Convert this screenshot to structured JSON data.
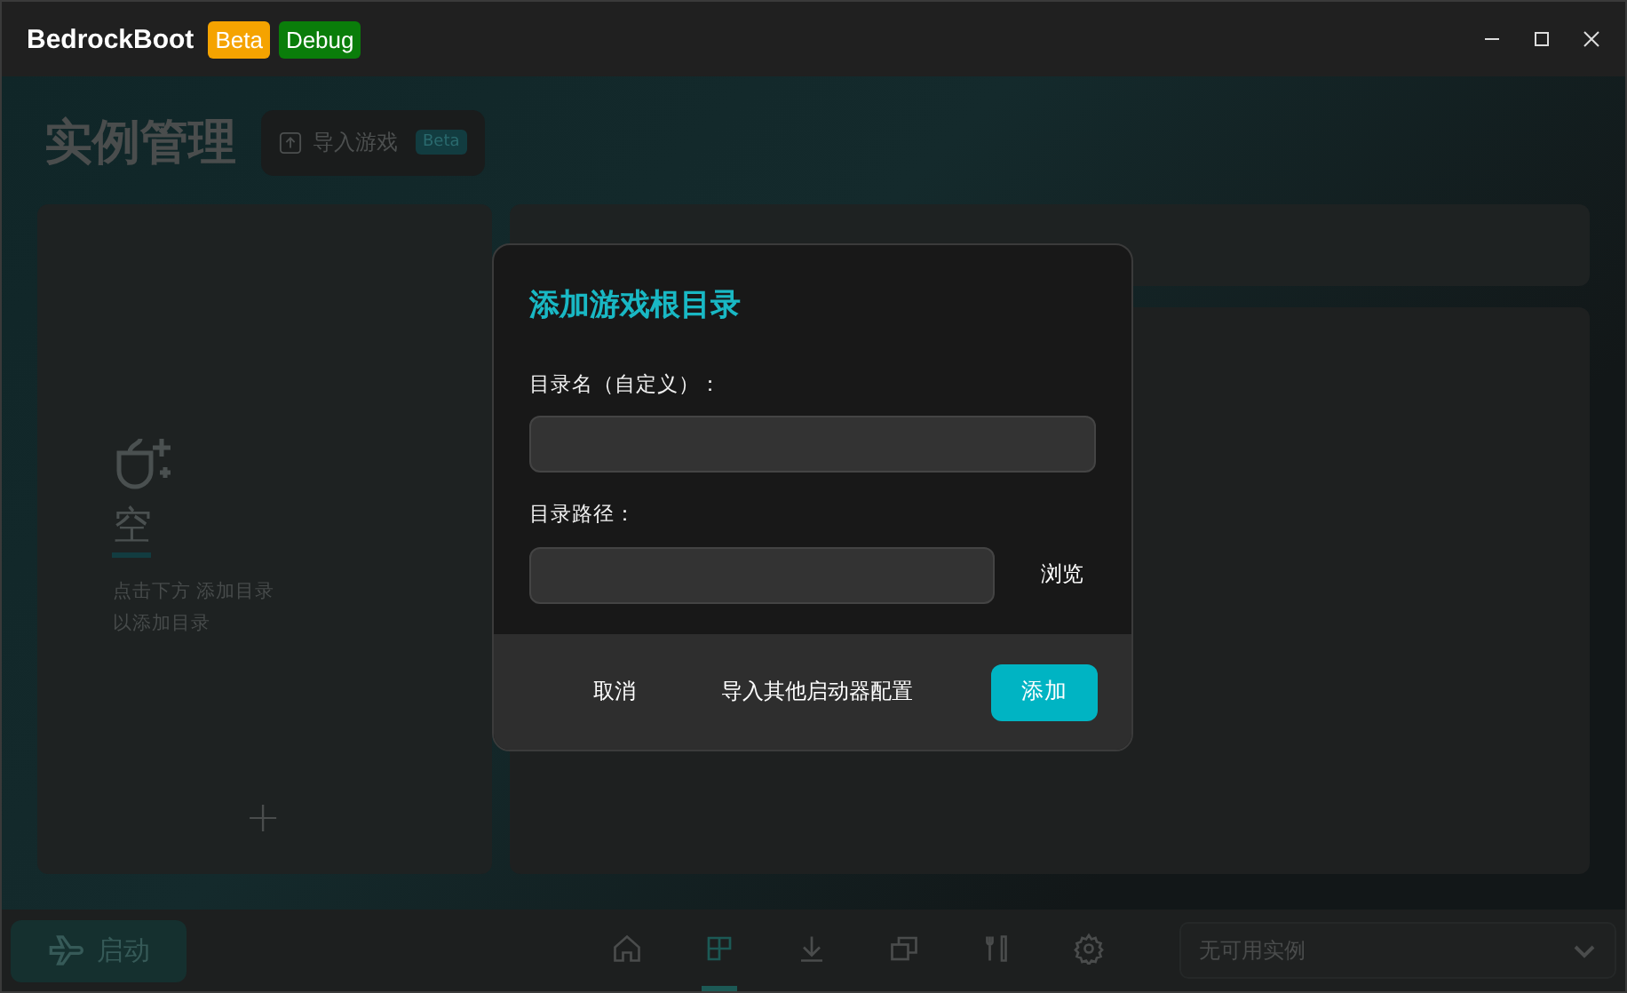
{
  "window": {
    "title": "BedrockBoot",
    "badges": [
      {
        "label": "Beta",
        "color": "#f5a300"
      },
      {
        "label": "Debug",
        "color": "#0a7d0a"
      }
    ]
  },
  "header": {
    "title": "实例管理",
    "import_button": {
      "label": "导入游戏",
      "badge": "Beta"
    }
  },
  "left_panel": {
    "empty_glyph": "空",
    "hint_lines": [
      "点击下方 添加目录",
      "以添加目录"
    ],
    "add_symbol": "+"
  },
  "bottom_bar": {
    "start_button": "启动",
    "nav": [
      {
        "selected": false
      },
      {
        "selected": true
      },
      {
        "selected": false
      },
      {
        "selected": false
      },
      {
        "selected": false
      },
      {
        "selected": false
      }
    ],
    "instance_select": "无可用实例"
  },
  "dialog": {
    "title": "添加游戏根目录",
    "fields": [
      {
        "label": "目录名（自定义）：",
        "kind": "text"
      },
      {
        "label": "目录路径：",
        "kind": "browse"
      }
    ],
    "browse": "浏览",
    "buttons": [
      {
        "label": "取消",
        "kind": "plain"
      },
      {
        "label": "导入其他启动器配置",
        "kind": "plain"
      },
      {
        "label": "添加",
        "kind": "primary"
      }
    ]
  }
}
